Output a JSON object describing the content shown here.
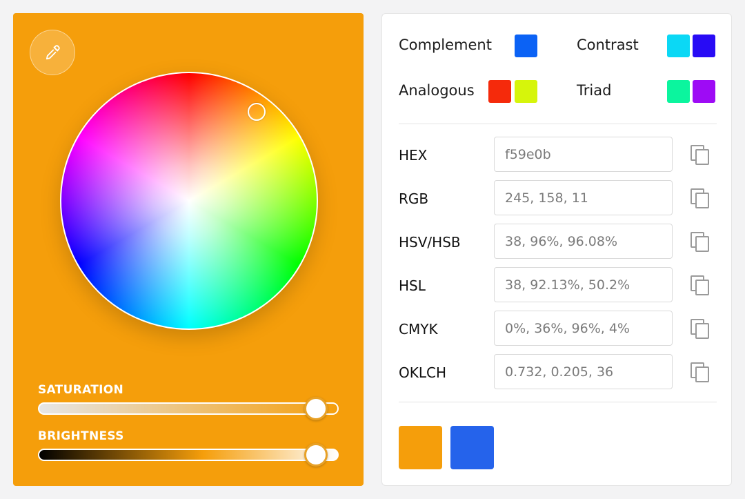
{
  "picker": {
    "eyedropper_icon": "eyedropper-icon",
    "saturation_label": "SATURATION",
    "brightness_label": "BRIGHTNESS",
    "saturation_value": 0.96,
    "brightness_value": 0.9608,
    "hue": 38
  },
  "harmonies": {
    "complement": {
      "label": "Complement",
      "colors": [
        "#0b62f5"
      ]
    },
    "contrast": {
      "label": "Contrast",
      "colors": [
        "#0bd8f5",
        "#280bf5"
      ]
    },
    "analogous": {
      "label": "Analogous",
      "colors": [
        "#f52a0b",
        "#d6f50b"
      ]
    },
    "triad": {
      "label": "Triad",
      "colors": [
        "#0bf59e",
        "#9e0bf5"
      ]
    }
  },
  "formats": [
    {
      "label": "HEX",
      "value": "f59e0b"
    },
    {
      "label": "RGB",
      "value": "245, 158, 11"
    },
    {
      "label": "HSV/HSB",
      "value": "38, 96%, 96.08%"
    },
    {
      "label": "HSL",
      "value": "38, 92.13%, 50.2%"
    },
    {
      "label": "CMYK",
      "value": "0%, 36%, 96%, 4%"
    },
    {
      "label": "OKLCH",
      "value": "0.732, 0.205, 36"
    }
  ],
  "current_colors": [
    "#f59e0b",
    "#2563eb"
  ],
  "colors": {
    "panel_bg": "#f59e0b",
    "accent": "#f59e0b"
  }
}
